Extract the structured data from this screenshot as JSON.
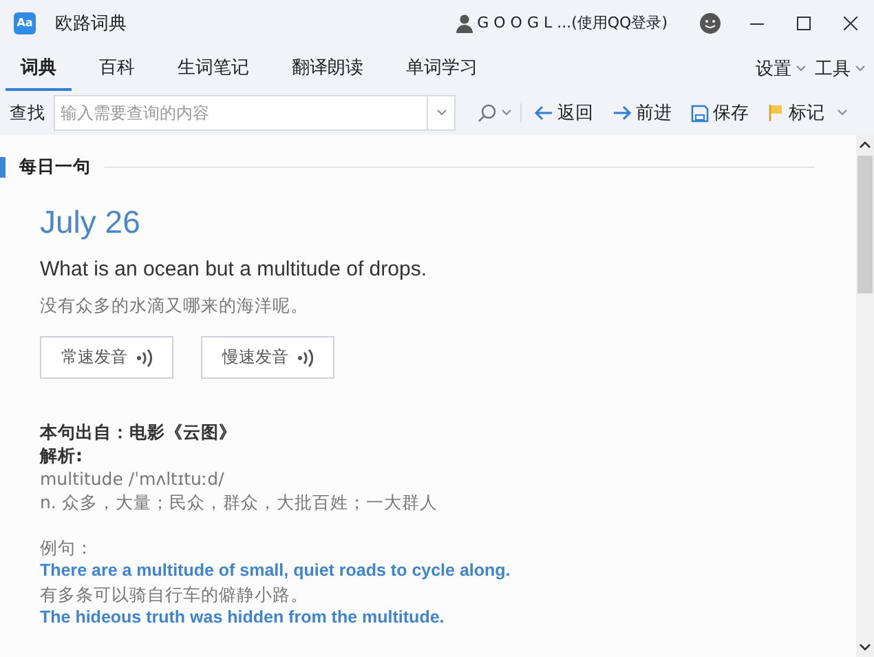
{
  "window": {
    "title": "欧路词典",
    "logo": "Aa",
    "user": "G O O G L ...(使用QQ登录)"
  },
  "tabs": [
    {
      "label": "词典",
      "selected": true
    },
    {
      "label": "百科",
      "selected": false
    },
    {
      "label": "生词笔记",
      "selected": false
    },
    {
      "label": "翻译朗读",
      "selected": false
    },
    {
      "label": "单词学习",
      "selected": false
    }
  ],
  "menus": [
    "设置",
    "工具"
  ],
  "search": {
    "label": "查找",
    "placeholder": "输入需要查询的内容"
  },
  "toolbar": [
    {
      "kind": "back",
      "label": "返回"
    },
    {
      "kind": "forward",
      "label": "前进"
    },
    {
      "kind": "save",
      "label": "保存"
    },
    {
      "kind": "mark",
      "label": "标记"
    }
  ],
  "section": {
    "title": "每日一句"
  },
  "daily": {
    "date": "July 26",
    "sentence": "What is an ocean but a multitude of drops.",
    "translation": "没有众多的水滴又哪来的海洋呢。",
    "audio_buttons": [
      "常速发音",
      "慢速发音"
    ],
    "source": "本句出自：电影《云图》",
    "analysis_label": "解析:",
    "word": "multitude /ˈmʌltɪtuːd/",
    "meaning": "n. 众多，大量；民众，群众，大批百姓；一大群人",
    "examples_label": "例句：",
    "examples": [
      {
        "kind": "en",
        "text": "There are a multitude of small, quiet roads to cycle along."
      },
      {
        "kind": "zh",
        "text": "有多条可以骑自行车的僻静小路。"
      },
      {
        "kind": "en",
        "text": "The hideous truth was hidden from the multitude."
      }
    ]
  }
}
